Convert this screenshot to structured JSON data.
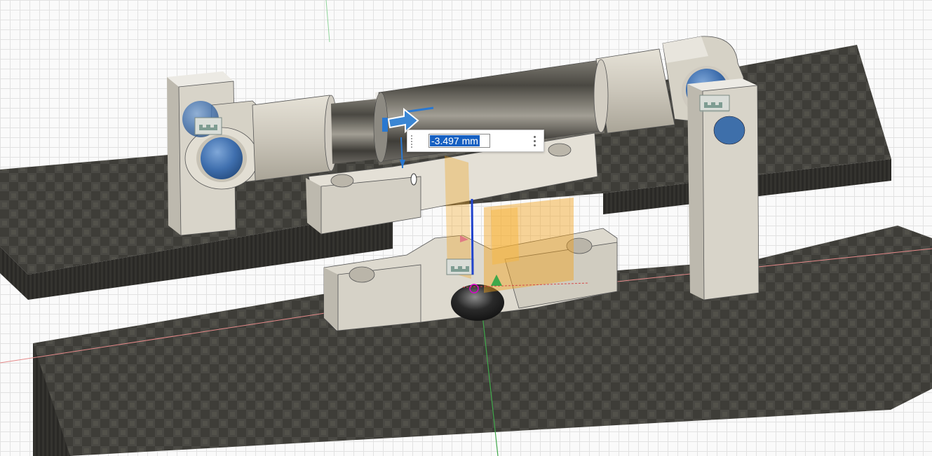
{
  "viewport": {
    "dimension_input": {
      "value": "-3.497 mm"
    },
    "icons": [
      "move-arrow-icon",
      "more-options-icon",
      "grip-icon"
    ],
    "colors": {
      "grid": "#e2e2e2",
      "background": "#fafafa",
      "carbon_plate": "#3a3934",
      "part_body": "#d8d4c9",
      "bearing_ball": "#4a7bb8",
      "selection": "#f2a21c",
      "axis_x": "#d64a4a",
      "axis_y": "#3fa84a",
      "axis_z": "#2244cc",
      "manipulator": "#3a86d4",
      "text_highlight": "#1660c2"
    }
  }
}
